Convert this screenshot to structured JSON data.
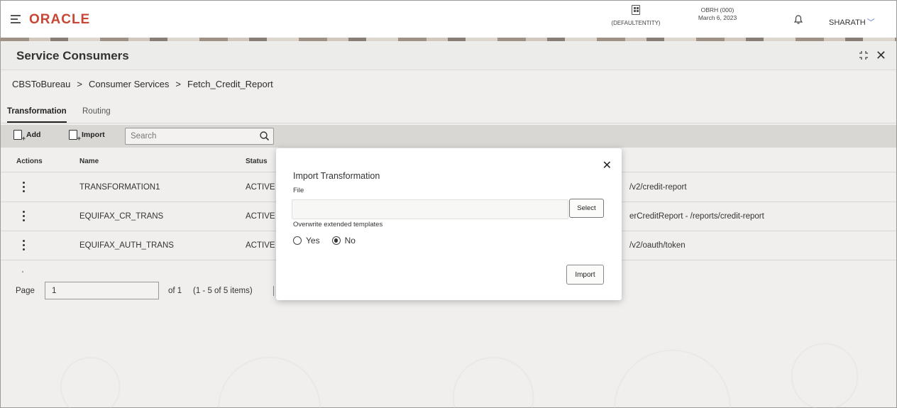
{
  "header": {
    "logo": "ORACLE",
    "entity_label": "(DEFAULTENTITY)",
    "branch": "OBRH (000)",
    "date": "March 6, 2023",
    "user": "SHARATH"
  },
  "page": {
    "title": "Service Consumers"
  },
  "breadcrumb": {
    "items": [
      "CBSToBureau",
      "Consumer Services",
      "Fetch_Credit_Report"
    ],
    "separator": ">"
  },
  "tabs": [
    {
      "label": "Transformation",
      "active": true
    },
    {
      "label": "Routing",
      "active": false
    }
  ],
  "toolbar": {
    "add_label": "Add",
    "import_label": "Import",
    "search_placeholder": "Search"
  },
  "table": {
    "columns": [
      "Actions",
      "Name",
      "Status"
    ],
    "rows": [
      {
        "name": "TRANSFORMATION1",
        "status": "ACTIVE",
        "route": "/v2/credit-report"
      },
      {
        "name": "EQUIFAX_CR_TRANS",
        "status": "ACTIVE",
        "route": "erCreditReport - /reports/credit-report"
      },
      {
        "name": "EQUIFAX_AUTH_TRANS",
        "status": "ACTIVE",
        "route": "/v2/oauth/token"
      }
    ]
  },
  "pagination": {
    "label": "Page",
    "value": "1",
    "of_text": "of 1",
    "items_text": "(1 - 5 of 5 items)"
  },
  "modal": {
    "title": "Import Transformation",
    "file_label": "File",
    "select_label": "Select",
    "overwrite_label": "Overwrite extended templates",
    "options": [
      {
        "label": "Yes",
        "checked": false
      },
      {
        "label": "No",
        "checked": true
      }
    ],
    "import_label": "Import"
  }
}
